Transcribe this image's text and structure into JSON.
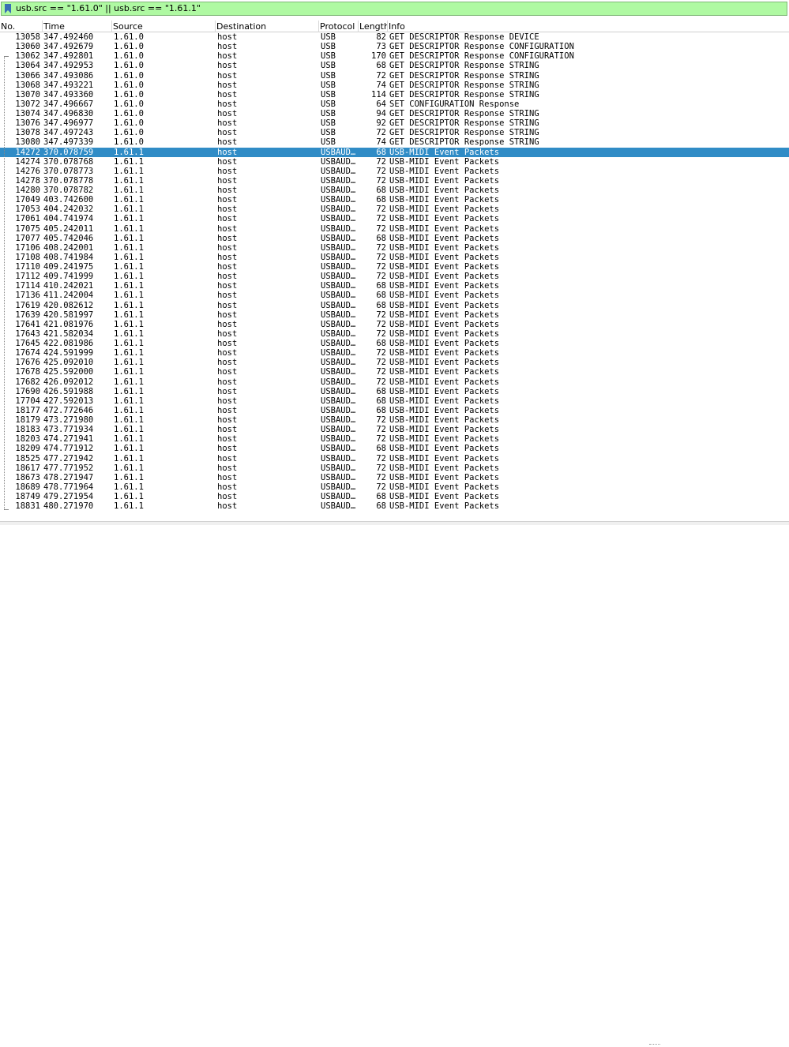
{
  "filter": {
    "text": "usb.src == \"1.61.0\" || usb.src == \"1.61.1\"",
    "bg_color": "#aff9a2"
  },
  "columns": {
    "no": "No.",
    "time": "Time",
    "source": "Source",
    "destination": "Destination",
    "protocol": "Protocol",
    "length": "Length",
    "info": "Info"
  },
  "selection_color": "#308cc6",
  "selected_no": "14272",
  "rows": [
    {
      "no": "13058",
      "time": "347.492460",
      "src": "1.61.0",
      "dst": "host",
      "proto": "USB",
      "len": "82",
      "info": "GET DESCRIPTOR Response DEVICE"
    },
    {
      "no": "13060",
      "time": "347.492679",
      "src": "1.61.0",
      "dst": "host",
      "proto": "USB",
      "len": "73",
      "info": "GET DESCRIPTOR Response CONFIGURATION"
    },
    {
      "no": "13062",
      "time": "347.492801",
      "src": "1.61.0",
      "dst": "host",
      "proto": "USB",
      "len": "170",
      "info": "GET DESCRIPTOR Response CONFIGURATION"
    },
    {
      "no": "13064",
      "time": "347.492953",
      "src": "1.61.0",
      "dst": "host",
      "proto": "USB",
      "len": "68",
      "info": "GET DESCRIPTOR Response STRING"
    },
    {
      "no": "13066",
      "time": "347.493086",
      "src": "1.61.0",
      "dst": "host",
      "proto": "USB",
      "len": "72",
      "info": "GET DESCRIPTOR Response STRING"
    },
    {
      "no": "13068",
      "time": "347.493221",
      "src": "1.61.0",
      "dst": "host",
      "proto": "USB",
      "len": "74",
      "info": "GET DESCRIPTOR Response STRING"
    },
    {
      "no": "13070",
      "time": "347.493360",
      "src": "1.61.0",
      "dst": "host",
      "proto": "USB",
      "len": "114",
      "info": "GET DESCRIPTOR Response STRING"
    },
    {
      "no": "13072",
      "time": "347.496667",
      "src": "1.61.0",
      "dst": "host",
      "proto": "USB",
      "len": "64",
      "info": "SET CONFIGURATION Response"
    },
    {
      "no": "13074",
      "time": "347.496830",
      "src": "1.61.0",
      "dst": "host",
      "proto": "USB",
      "len": "94",
      "info": "GET DESCRIPTOR Response STRING"
    },
    {
      "no": "13076",
      "time": "347.496977",
      "src": "1.61.0",
      "dst": "host",
      "proto": "USB",
      "len": "92",
      "info": "GET DESCRIPTOR Response STRING"
    },
    {
      "no": "13078",
      "time": "347.497243",
      "src": "1.61.0",
      "dst": "host",
      "proto": "USB",
      "len": "72",
      "info": "GET DESCRIPTOR Response STRING"
    },
    {
      "no": "13080",
      "time": "347.497339",
      "src": "1.61.0",
      "dst": "host",
      "proto": "USB",
      "len": "74",
      "info": "GET DESCRIPTOR Response STRING"
    },
    {
      "no": "14272",
      "time": "370.078759",
      "src": "1.61.1",
      "dst": "host",
      "proto": "USBAUD…",
      "len": "68",
      "info": "USB-MIDI Event Packets"
    },
    {
      "no": "14274",
      "time": "370.078768",
      "src": "1.61.1",
      "dst": "host",
      "proto": "USBAUD…",
      "len": "72",
      "info": "USB-MIDI Event Packets"
    },
    {
      "no": "14276",
      "time": "370.078773",
      "src": "1.61.1",
      "dst": "host",
      "proto": "USBAUD…",
      "len": "72",
      "info": "USB-MIDI Event Packets"
    },
    {
      "no": "14278",
      "time": "370.078778",
      "src": "1.61.1",
      "dst": "host",
      "proto": "USBAUD…",
      "len": "72",
      "info": "USB-MIDI Event Packets"
    },
    {
      "no": "14280",
      "time": "370.078782",
      "src": "1.61.1",
      "dst": "host",
      "proto": "USBAUD…",
      "len": "68",
      "info": "USB-MIDI Event Packets"
    },
    {
      "no": "17049",
      "time": "403.742600",
      "src": "1.61.1",
      "dst": "host",
      "proto": "USBAUD…",
      "len": "68",
      "info": "USB-MIDI Event Packets"
    },
    {
      "no": "17053",
      "time": "404.242032",
      "src": "1.61.1",
      "dst": "host",
      "proto": "USBAUD…",
      "len": "72",
      "info": "USB-MIDI Event Packets"
    },
    {
      "no": "17061",
      "time": "404.741974",
      "src": "1.61.1",
      "dst": "host",
      "proto": "USBAUD…",
      "len": "72",
      "info": "USB-MIDI Event Packets"
    },
    {
      "no": "17075",
      "time": "405.242011",
      "src": "1.61.1",
      "dst": "host",
      "proto": "USBAUD…",
      "len": "72",
      "info": "USB-MIDI Event Packets"
    },
    {
      "no": "17077",
      "time": "405.742046",
      "src": "1.61.1",
      "dst": "host",
      "proto": "USBAUD…",
      "len": "68",
      "info": "USB-MIDI Event Packets"
    },
    {
      "no": "17106",
      "time": "408.242001",
      "src": "1.61.1",
      "dst": "host",
      "proto": "USBAUD…",
      "len": "72",
      "info": "USB-MIDI Event Packets"
    },
    {
      "no": "17108",
      "time": "408.741984",
      "src": "1.61.1",
      "dst": "host",
      "proto": "USBAUD…",
      "len": "72",
      "info": "USB-MIDI Event Packets"
    },
    {
      "no": "17110",
      "time": "409.241975",
      "src": "1.61.1",
      "dst": "host",
      "proto": "USBAUD…",
      "len": "72",
      "info": "USB-MIDI Event Packets"
    },
    {
      "no": "17112",
      "time": "409.741999",
      "src": "1.61.1",
      "dst": "host",
      "proto": "USBAUD…",
      "len": "72",
      "info": "USB-MIDI Event Packets"
    },
    {
      "no": "17114",
      "time": "410.242021",
      "src": "1.61.1",
      "dst": "host",
      "proto": "USBAUD…",
      "len": "68",
      "info": "USB-MIDI Event Packets"
    },
    {
      "no": "17136",
      "time": "411.242004",
      "src": "1.61.1",
      "dst": "host",
      "proto": "USBAUD…",
      "len": "68",
      "info": "USB-MIDI Event Packets"
    },
    {
      "no": "17619",
      "time": "420.082612",
      "src": "1.61.1",
      "dst": "host",
      "proto": "USBAUD…",
      "len": "68",
      "info": "USB-MIDI Event Packets"
    },
    {
      "no": "17639",
      "time": "420.581997",
      "src": "1.61.1",
      "dst": "host",
      "proto": "USBAUD…",
      "len": "72",
      "info": "USB-MIDI Event Packets"
    },
    {
      "no": "17641",
      "time": "421.081976",
      "src": "1.61.1",
      "dst": "host",
      "proto": "USBAUD…",
      "len": "72",
      "info": "USB-MIDI Event Packets"
    },
    {
      "no": "17643",
      "time": "421.582034",
      "src": "1.61.1",
      "dst": "host",
      "proto": "USBAUD…",
      "len": "72",
      "info": "USB-MIDI Event Packets"
    },
    {
      "no": "17645",
      "time": "422.081986",
      "src": "1.61.1",
      "dst": "host",
      "proto": "USBAUD…",
      "len": "68",
      "info": "USB-MIDI Event Packets"
    },
    {
      "no": "17674",
      "time": "424.591999",
      "src": "1.61.1",
      "dst": "host",
      "proto": "USBAUD…",
      "len": "72",
      "info": "USB-MIDI Event Packets"
    },
    {
      "no": "17676",
      "time": "425.092010",
      "src": "1.61.1",
      "dst": "host",
      "proto": "USBAUD…",
      "len": "72",
      "info": "USB-MIDI Event Packets"
    },
    {
      "no": "17678",
      "time": "425.592000",
      "src": "1.61.1",
      "dst": "host",
      "proto": "USBAUD…",
      "len": "72",
      "info": "USB-MIDI Event Packets"
    },
    {
      "no": "17682",
      "time": "426.092012",
      "src": "1.61.1",
      "dst": "host",
      "proto": "USBAUD…",
      "len": "72",
      "info": "USB-MIDI Event Packets"
    },
    {
      "no": "17690",
      "time": "426.591988",
      "src": "1.61.1",
      "dst": "host",
      "proto": "USBAUD…",
      "len": "68",
      "info": "USB-MIDI Event Packets"
    },
    {
      "no": "17704",
      "time": "427.592013",
      "src": "1.61.1",
      "dst": "host",
      "proto": "USBAUD…",
      "len": "68",
      "info": "USB-MIDI Event Packets"
    },
    {
      "no": "18177",
      "time": "472.772646",
      "src": "1.61.1",
      "dst": "host",
      "proto": "USBAUD…",
      "len": "68",
      "info": "USB-MIDI Event Packets"
    },
    {
      "no": "18179",
      "time": "473.271980",
      "src": "1.61.1",
      "dst": "host",
      "proto": "USBAUD…",
      "len": "72",
      "info": "USB-MIDI Event Packets"
    },
    {
      "no": "18183",
      "time": "473.771934",
      "src": "1.61.1",
      "dst": "host",
      "proto": "USBAUD…",
      "len": "72",
      "info": "USB-MIDI Event Packets"
    },
    {
      "no": "18203",
      "time": "474.271941",
      "src": "1.61.1",
      "dst": "host",
      "proto": "USBAUD…",
      "len": "72",
      "info": "USB-MIDI Event Packets"
    },
    {
      "no": "18209",
      "time": "474.771912",
      "src": "1.61.1",
      "dst": "host",
      "proto": "USBAUD…",
      "len": "68",
      "info": "USB-MIDI Event Packets"
    },
    {
      "no": "18525",
      "time": "477.271942",
      "src": "1.61.1",
      "dst": "host",
      "proto": "USBAUD…",
      "len": "72",
      "info": "USB-MIDI Event Packets"
    },
    {
      "no": "18617",
      "time": "477.771952",
      "src": "1.61.1",
      "dst": "host",
      "proto": "USBAUD…",
      "len": "72",
      "info": "USB-MIDI Event Packets"
    },
    {
      "no": "18673",
      "time": "478.271947",
      "src": "1.61.1",
      "dst": "host",
      "proto": "USBAUD…",
      "len": "72",
      "info": "USB-MIDI Event Packets"
    },
    {
      "no": "18689",
      "time": "478.771964",
      "src": "1.61.1",
      "dst": "host",
      "proto": "USBAUD…",
      "len": "72",
      "info": "USB-MIDI Event Packets"
    },
    {
      "no": "18749",
      "time": "479.271954",
      "src": "1.61.1",
      "dst": "host",
      "proto": "USBAUD…",
      "len": "68",
      "info": "USB-MIDI Event Packets"
    },
    {
      "no": "18831",
      "time": "480.271970",
      "src": "1.61.1",
      "dst": "host",
      "proto": "USBAUD…",
      "len": "68",
      "info": "USB-MIDI Event Packets"
    }
  ]
}
